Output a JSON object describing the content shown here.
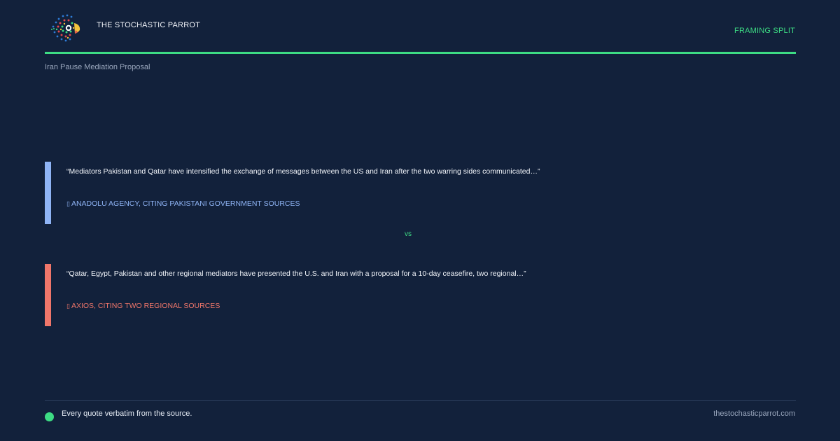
{
  "header": {
    "brand": "THE STOCHASTIC PARROT",
    "tag": "FRAMING SPLIT",
    "logo_icon": "parrot-logo-icon"
  },
  "topic": "Iran Pause Mediation Proposal",
  "quotes": [
    {
      "text": "“Mediators Pakistan and Qatar have intensified the exchange of messages between the US and Iran after the two warring sides communicated…”",
      "source": "ANADOLU AGENCY, CITING PAKISTANI GOVERNMENT SOURCES",
      "accent": "#8fb4f5"
    },
    {
      "text": "“Qatar, Egypt, Pakistan and other regional mediators have presented the U.S. and Iran with a proposal for a 10-day ceasefire, two regional…”",
      "source": "AXIOS, CITING TWO REGIONAL SOURCES",
      "accent": "#f0766a"
    }
  ],
  "vs_label": "vs",
  "footer": {
    "note": "Every quote verbatim from the source.",
    "site": "thestochasticparrot.com"
  },
  "colors": {
    "background": "#12213b",
    "accent": "#3ddc84"
  }
}
